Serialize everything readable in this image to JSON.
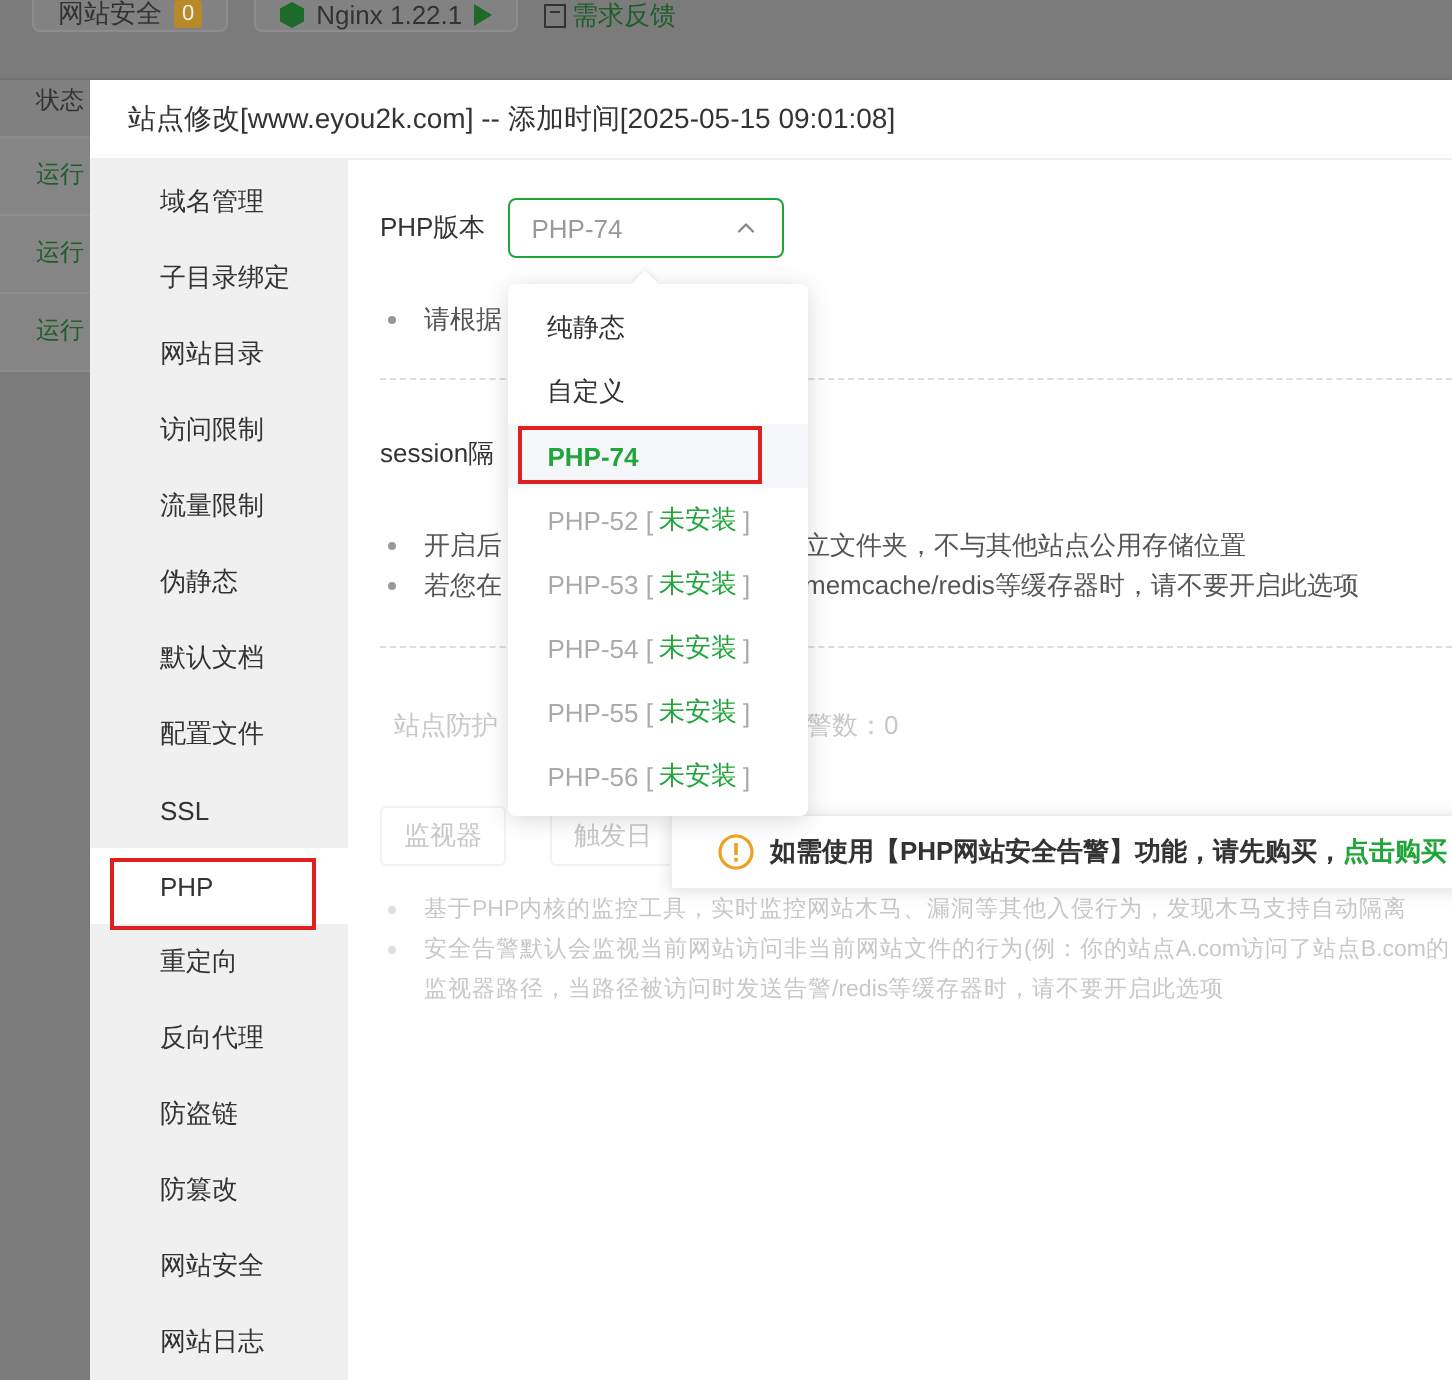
{
  "top_bar": {
    "security_button": {
      "label": "网站安全",
      "badge": "0"
    },
    "server_button": {
      "label": "Nginx 1.22.1"
    },
    "feedback_link": {
      "label": "需求反馈"
    }
  },
  "background_table": {
    "header": "状态",
    "rows": [
      "运行",
      "运行",
      "运行"
    ]
  },
  "dialog": {
    "title": "站点修改[www.eyou2k.com] -- 添加时间[2025-05-15 09:01:08]"
  },
  "sidebar": {
    "items": [
      {
        "label": "域名管理",
        "selected": false,
        "marked": false
      },
      {
        "label": "子目录绑定",
        "selected": false,
        "marked": false
      },
      {
        "label": "网站目录",
        "selected": false,
        "marked": false
      },
      {
        "label": "访问限制",
        "selected": false,
        "marked": false
      },
      {
        "label": "流量限制",
        "selected": false,
        "marked": false
      },
      {
        "label": "伪静态",
        "selected": false,
        "marked": false
      },
      {
        "label": "默认文档",
        "selected": false,
        "marked": false
      },
      {
        "label": "配置文件",
        "selected": false,
        "marked": false
      },
      {
        "label": "SSL",
        "selected": false,
        "marked": false
      },
      {
        "label": "PHP",
        "selected": true,
        "marked": true
      },
      {
        "label": "重定向",
        "selected": false,
        "marked": false
      },
      {
        "label": "反向代理",
        "selected": false,
        "marked": false
      },
      {
        "label": "防盗链",
        "selected": false,
        "marked": false
      },
      {
        "label": "防篡改",
        "selected": false,
        "marked": false
      },
      {
        "label": "网站安全",
        "selected": false,
        "marked": false
      },
      {
        "label": "网站日志",
        "selected": false,
        "marked": false
      }
    ]
  },
  "php_version": {
    "label": "PHP版本",
    "value": "PHP-74",
    "expanded": true,
    "options": [
      {
        "label": "纯静态",
        "installed": true,
        "selected": false,
        "marked": false
      },
      {
        "label": "自定义",
        "installed": true,
        "selected": false,
        "marked": false
      },
      {
        "label": "PHP-74",
        "installed": true,
        "selected": true,
        "marked": true
      },
      {
        "label": "PHP-52",
        "installed": false,
        "open": "[",
        "status": "未安装",
        "close": "]",
        "selected": false,
        "marked": false
      },
      {
        "label": "PHP-53",
        "installed": false,
        "open": "[",
        "status": "未安装",
        "close": "]",
        "selected": false,
        "marked": false
      },
      {
        "label": "PHP-54",
        "installed": false,
        "open": "[",
        "status": "未安装",
        "close": "]",
        "selected": false,
        "marked": false
      },
      {
        "label": "PHP-55",
        "installed": false,
        "open": "[",
        "status": "未安装",
        "close": "]",
        "selected": false,
        "marked": false
      },
      {
        "label": "PHP-56",
        "installed": false,
        "open": "[",
        "status": "未安装",
        "close": "]",
        "selected": false,
        "marked": false
      }
    ]
  },
  "hint_note": "请根据",
  "session": {
    "label": "session隔",
    "notes": [
      {
        "left": "开启后",
        "right": "立文件夹，不与其他站点公用存储位置"
      },
      {
        "left": "若您在",
        "right": "memcache/redis等缓存器时，请不要开启此选项"
      }
    ]
  },
  "protection": {
    "disabled": true,
    "left": "站点防护",
    "right": "警数：0",
    "tabs": [
      {
        "label": "监视器",
        "selected": false
      },
      {
        "label": "触发日",
        "selected": false
      }
    ],
    "notes": [
      {
        "text": "基于PHP内核的监控工具，实时监控网站木马、漏洞等其他入侵行为，发现木马支持自动隔离",
        "bullet": true
      },
      {
        "text": "安全告警默认会监视当前网站访问非当前网站文件的行为(例：你的站点A.com访问了站点B.com的",
        "bullet": true
      },
      {
        "text": "监视器路径，当路径被访问时发送告警/redis等缓存器时，请不要开启此选项",
        "bullet": false
      }
    ]
  },
  "toast": {
    "text": "如需使用【PHP网站安全告警】功能，请先购买，",
    "link": "点击购买"
  }
}
